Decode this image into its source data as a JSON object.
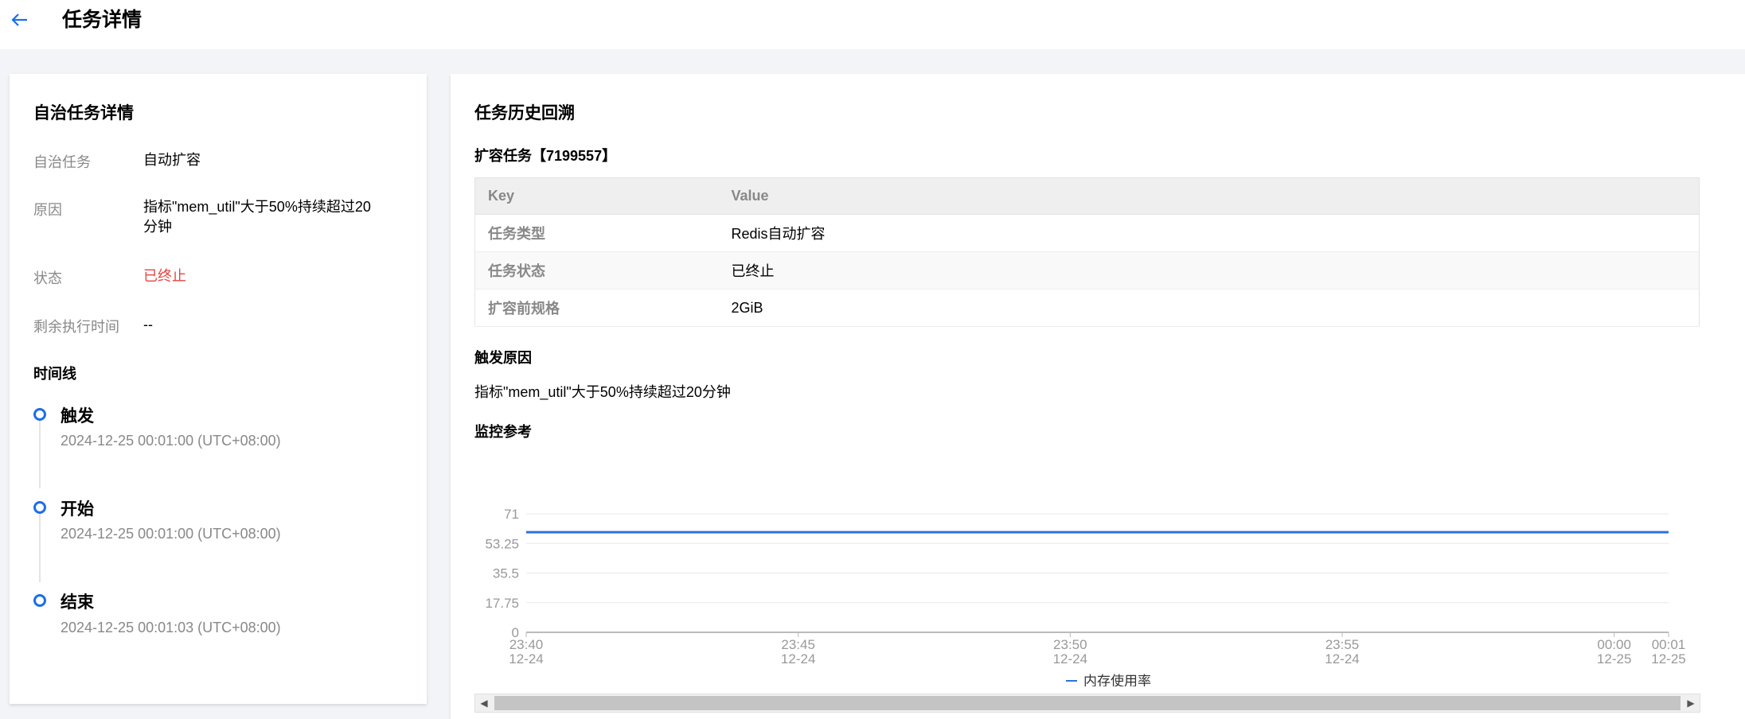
{
  "header": {
    "title": "任务详情",
    "back_icon": "arrow-left-icon"
  },
  "left": {
    "title": "自治任务详情",
    "fields": [
      {
        "label": "自治任务",
        "value": "自动扩容"
      },
      {
        "label": "原因",
        "value": "指标\"mem_util\"大于50%持续超过20分钟"
      },
      {
        "label": "状态",
        "value": "已终止",
        "color": "#e54545"
      },
      {
        "label": "剩余执行时间",
        "value": "--"
      }
    ],
    "timeline_title": "时间线",
    "timeline": [
      {
        "title": "触发",
        "time": "2024-12-25 00:01:00 (UTC+08:00)"
      },
      {
        "title": "开始",
        "time": "2024-12-25 00:01:00 (UTC+08:00)"
      },
      {
        "title": "结束",
        "time": "2024-12-25 00:01:03 (UTC+08:00)"
      }
    ]
  },
  "right": {
    "title": "任务历史回溯",
    "task_name": "扩容任务【7199557】",
    "table": {
      "headers": [
        "Key",
        "Value"
      ],
      "rows": [
        [
          "任务类型",
          "Redis自动扩容"
        ],
        [
          "任务状态",
          "已终止"
        ],
        [
          "扩容前规格",
          "2GiB"
        ]
      ]
    },
    "trigger_title": "触发原因",
    "trigger_text": "指标\"mem_util\"大于50%持续超过20分钟",
    "monitor_title": "监控参考"
  },
  "chart_data": {
    "type": "line",
    "y_ticks": [
      "71",
      "53.25",
      "35.5",
      "17.75",
      "0"
    ],
    "ylim": [
      0,
      71
    ],
    "x_ticks": [
      {
        "time": "23:40",
        "date": "12-24"
      },
      {
        "time": "23:45",
        "date": "12-24"
      },
      {
        "time": "23:50",
        "date": "12-24"
      },
      {
        "time": "23:55",
        "date": "12-24"
      },
      {
        "time": "00:00",
        "date": "12-25"
      },
      {
        "time": "00:01",
        "date": "12-25"
      }
    ],
    "x_minutes": [
      0,
      5,
      10,
      15,
      20,
      21
    ],
    "series": [
      {
        "name": "内存使用率",
        "color": "#2f6fde",
        "x": [
          "23:40",
          "00:01"
        ],
        "values": [
          60,
          60
        ]
      }
    ],
    "grid": true
  }
}
